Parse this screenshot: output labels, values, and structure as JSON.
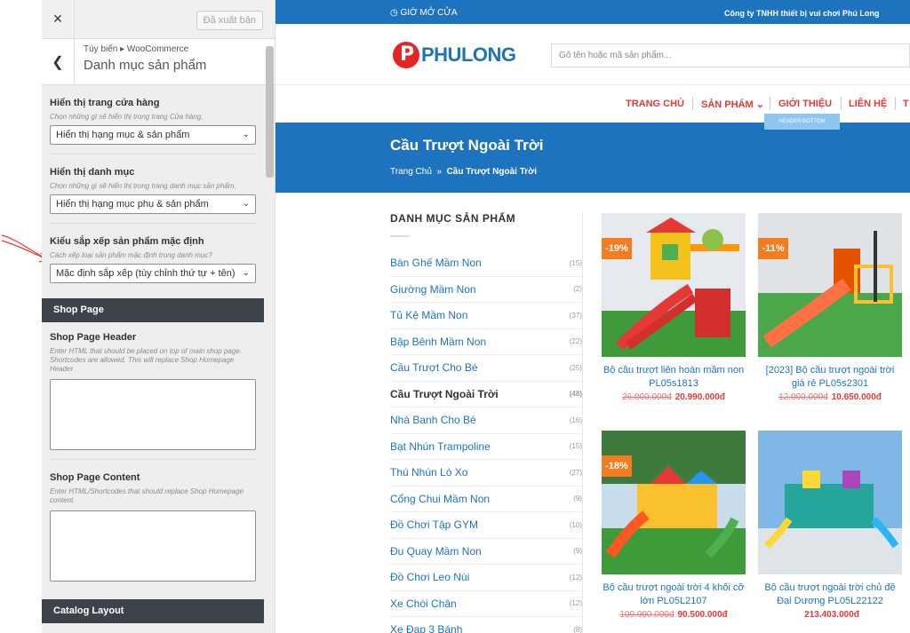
{
  "customizer": {
    "close_icon": "×",
    "publish_label": "Đã xuất bản",
    "breadcrumb": "Tùy biến ▸ WooCommerce",
    "title": "Danh mục sản phẩm",
    "sections": [
      {
        "label": "Hiển thị trang cửa hàng",
        "description": "Chọn những gì sẽ hiển thị trong trang Cửa hàng.",
        "value": "Hiển thị hạng mục & sản phẩm"
      },
      {
        "label": "Hiển thị danh mục",
        "description": "Chọn những gì sẽ hiển thị trong trang danh mục sản phẩm.",
        "value": "Hiển thị hạng mục phụ & sản phẩm"
      },
      {
        "label": "Kiểu sắp xếp sản phẩm mặc định",
        "description": "Cách xếp loại sản phẩm mặc định trong danh mục?",
        "value": "Mặc định sắp xếp (tùy chỉnh thứ tự + tên)"
      }
    ],
    "shop_page_band": "Shop Page",
    "shop_page_header_label": "Shop Page Header",
    "shop_page_header_desc": "Enter HTML that should be placed on top of main shop page. Shortcodes are allowed. This will replace Shop Homepage Header",
    "shop_page_content_label": "Shop Page Content",
    "shop_page_content_desc": "Enter HTML/Shortcodes that should replace Shop Homepage content.",
    "catalog_layout_band": "Catalog Layout"
  },
  "site": {
    "hours": "◷ GIỜ MỞ CỬA",
    "company": "Công ty TNHH thiết bị vui chơi Phú Long",
    "logo_text": "PHULONG",
    "search_placeholder": "Gõ tên hoặc mã sản phẩm...",
    "nav": [
      "TRANG CHỦ",
      "SẢN PHẨM ⌄",
      "GIỚI THIỆU",
      "LIÊN HỆ",
      "T"
    ],
    "nav_badge": "HEADER BOTTOM",
    "page_title": "Cầu Trượt Ngoài Trời",
    "breadcrumb_home": "Trang Chủ",
    "breadcrumb_sep": "»",
    "breadcrumb_current": "Cầu Trượt Ngoài Trời",
    "catalog_heading": "DANH MỤC SẢN PHẨM",
    "categories": [
      {
        "name": "Bàn Ghế Mầm Non",
        "count": "(15)"
      },
      {
        "name": "Giường Mầm Non",
        "count": "(2)"
      },
      {
        "name": "Tủ Kệ Mầm Non",
        "count": "(37)"
      },
      {
        "name": "Bập Bênh Mầm Non",
        "count": "(22)"
      },
      {
        "name": "Cầu Trượt Cho Bé",
        "count": "(25)"
      },
      {
        "name": "Cầu Trượt Ngoài Trời",
        "count": "(48)"
      },
      {
        "name": "Nhà Banh Cho Bé",
        "count": "(16)"
      },
      {
        "name": "Bạt Nhún Trampoline",
        "count": "(15)"
      },
      {
        "name": "Thú Nhún Lò Xo",
        "count": "(27)"
      },
      {
        "name": "Cổng Chui Mầm Non",
        "count": "(9)"
      },
      {
        "name": "Đồ Chơi Tập GYM",
        "count": "(10)"
      },
      {
        "name": "Đu Quay Mầm Non",
        "count": "(9)"
      },
      {
        "name": "Đồ Chơi Leo Núi",
        "count": "(12)"
      },
      {
        "name": "Xe Chòi Chân",
        "count": "(12)"
      },
      {
        "name": "Xe Đạp 3 Bánh",
        "count": "(8)"
      }
    ],
    "products": [
      {
        "sale": "-19%",
        "name": "Bộ cầu trượt liên hoàn mầm non PL05s1813",
        "old_price": "26.000.000đ",
        "new_price": "20.990.000đ"
      },
      {
        "sale": "-11%",
        "name": "[2023] Bộ cầu trượt ngoài trời giá rẻ PL05s2301",
        "old_price": "12.000.000đ",
        "new_price": "10.650.000đ"
      },
      {
        "sale": "-18%",
        "name": "Bộ cầu trượt ngoài trời 4 khối cỡ lớn PL05L2107",
        "old_price": "109.990.000đ",
        "new_price": "90.500.000đ"
      },
      {
        "sale": "",
        "name": "Bộ cầu trượt ngoài trời chủ đề Đại Dương PL05L22122",
        "old_price": "",
        "new_price": "213.403.000đ"
      }
    ]
  }
}
